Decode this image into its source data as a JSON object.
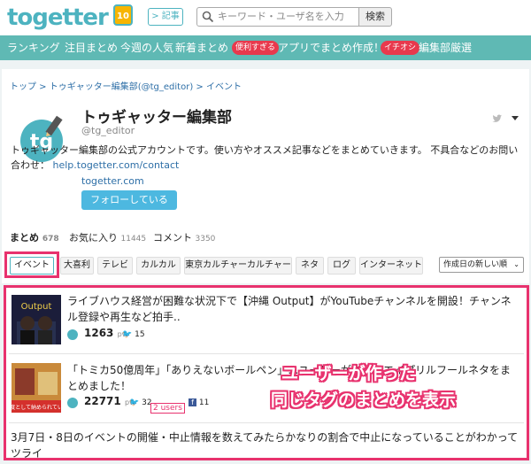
{
  "header": {
    "logo": "togetter",
    "logo_badge": "10",
    "article_button": "> 記事",
    "search_placeholder": "キーワード・ユーザ名を入力",
    "search_button": "検索"
  },
  "nav": {
    "items": [
      "ランキング",
      "注目まとめ",
      "今週の人気",
      "新着まとめ"
    ],
    "promo_badge": "便利すぎる",
    "promo_text": "アプリでまとめ作成！",
    "pick_badge": "イチオシ",
    "pick_text": "編集部厳選"
  },
  "breadcrumb": "トップ > トゥギャッター編集部(@tg_editor) > イベント",
  "profile": {
    "name": "トゥギャッター編集部",
    "handle": "@tg_editor",
    "description": "トゥギャッター編集部の公式アカウントです。使い方やオススメ記事などをまとめていきます。 不具合などのお問い合わせ：",
    "contact_link": "help.togetter.com/contact",
    "site": "togetter.com",
    "follow_button": "フォローしている"
  },
  "stats": [
    {
      "label": "まとめ",
      "count": "678"
    },
    {
      "label": "お気に入り",
      "count": "11445"
    },
    {
      "label": "コメント",
      "count": "3350"
    }
  ],
  "tags": [
    "イベント",
    "大喜利",
    "テレビ",
    "カルカル",
    "東京カルチャーカルチャー",
    "ネタ",
    "ログ",
    "インターネット"
  ],
  "sort": "作成日の新しい順",
  "items": [
    {
      "title": "ライブハウス経営が困難な状況下で【沖縄 Output】がYouTubeチャンネルを開設！チャンネル登録や再生など拍手..",
      "pv": "1263",
      "tw": "15"
    },
    {
      "title": "「トミカ50億周年」「ありえないボールペン」…ユーザーが作ったエイプリルフールネタをまとめました！",
      "pv": "22771",
      "tw": "32",
      "users_badge": "2 users",
      "fb": "11"
    },
    {
      "title": "3月7日・8日のイベントの開催・中止情報を数えてみたらかなりの割合で中止になっていることがわかってツライ"
    }
  ],
  "overlay": {
    "line1": "ユーザーが作った",
    "line2": "同じタグのまとめを表示"
  },
  "colors": {
    "brand": "#4db3c0",
    "nav_bg": "#5fb9b4",
    "highlight": "#e8326e",
    "link": "#2e6fa7",
    "follow": "#4db8e0"
  }
}
